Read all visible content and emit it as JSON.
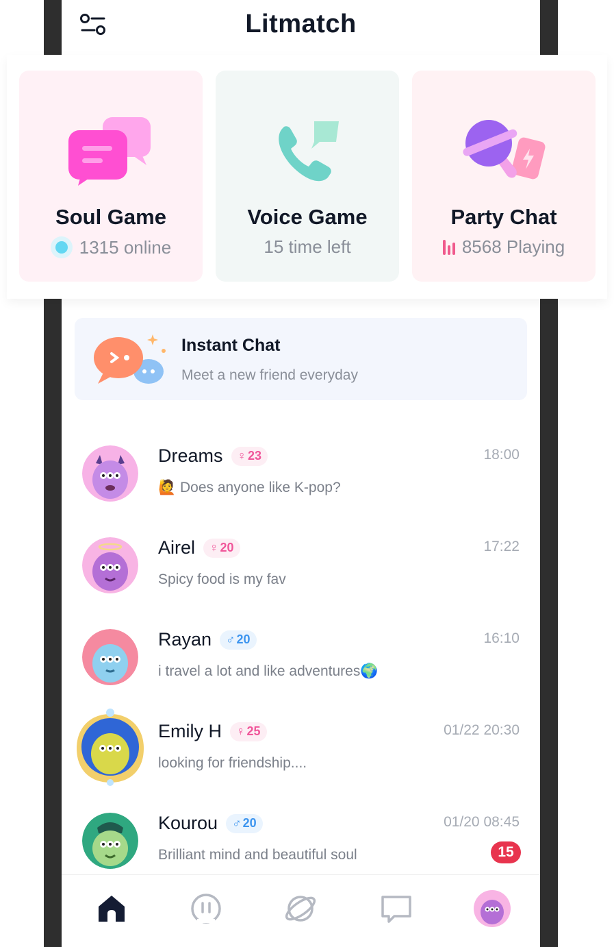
{
  "header": {
    "title": "Litmatch",
    "filter_icon": "filter-sliders-icon"
  },
  "cards": [
    {
      "id": "soul",
      "title": "Soul Game",
      "subtitle": "1315 online",
      "icon": "chat-bubbles-icon",
      "accent": "#ff5cd0"
    },
    {
      "id": "voice",
      "title": "Voice Game",
      "subtitle": "15 time left",
      "icon": "phone-icon",
      "accent": "#6fd3c8"
    },
    {
      "id": "party",
      "title": "Party Chat",
      "subtitle": "8568 Playing",
      "icon": "microphone-icon",
      "accent": "#9b5cf6"
    }
  ],
  "instant_chat": {
    "title": "Instant Chat",
    "subtitle": "Meet a new friend everyday"
  },
  "chats": [
    {
      "name": "Dreams",
      "gender": "female",
      "gender_symbol": "♀",
      "age": "23",
      "time": "18:00",
      "message": "🙋 Does anyone like K-pop?",
      "avatar_color": "#c48be6"
    },
    {
      "name": "Airel",
      "gender": "female",
      "gender_symbol": "♀",
      "age": "20",
      "time": "17:22",
      "message": "Spicy food is my fav",
      "avatar_color": "#b46fd6"
    },
    {
      "name": "Rayan",
      "gender": "male",
      "gender_symbol": "♂",
      "age": "20",
      "time": "16:10",
      "message": "i travel a lot and like adventures🌍",
      "avatar_color": "#8fd0ef"
    },
    {
      "name": "Emily H",
      "gender": "female",
      "gender_symbol": "♀",
      "age": "25",
      "time": "01/22 20:30",
      "message": "looking for friendship....",
      "avatar_color": "#d9d84a"
    },
    {
      "name": "Kourou",
      "gender": "male",
      "gender_symbol": "♂",
      "age": "20",
      "time": "01/20 08:45",
      "message": "Brilliant mind and beautiful soul",
      "avatar_color": "#a6d98a",
      "unread": "15"
    }
  ],
  "nav": [
    {
      "id": "home",
      "icon": "home-icon",
      "active": true
    },
    {
      "id": "voice",
      "icon": "voice-icon",
      "active": false
    },
    {
      "id": "planet",
      "icon": "planet-icon",
      "active": false
    },
    {
      "id": "messages",
      "icon": "message-icon",
      "active": false
    },
    {
      "id": "profile",
      "icon": "profile-avatar-icon",
      "active": false
    }
  ],
  "colors": {
    "primary_text": "#111827",
    "secondary_text": "#8a8f99",
    "female": "#f0569a",
    "male": "#3d95ef",
    "unread": "#e8344e",
    "frame": "#2e2e2e"
  }
}
